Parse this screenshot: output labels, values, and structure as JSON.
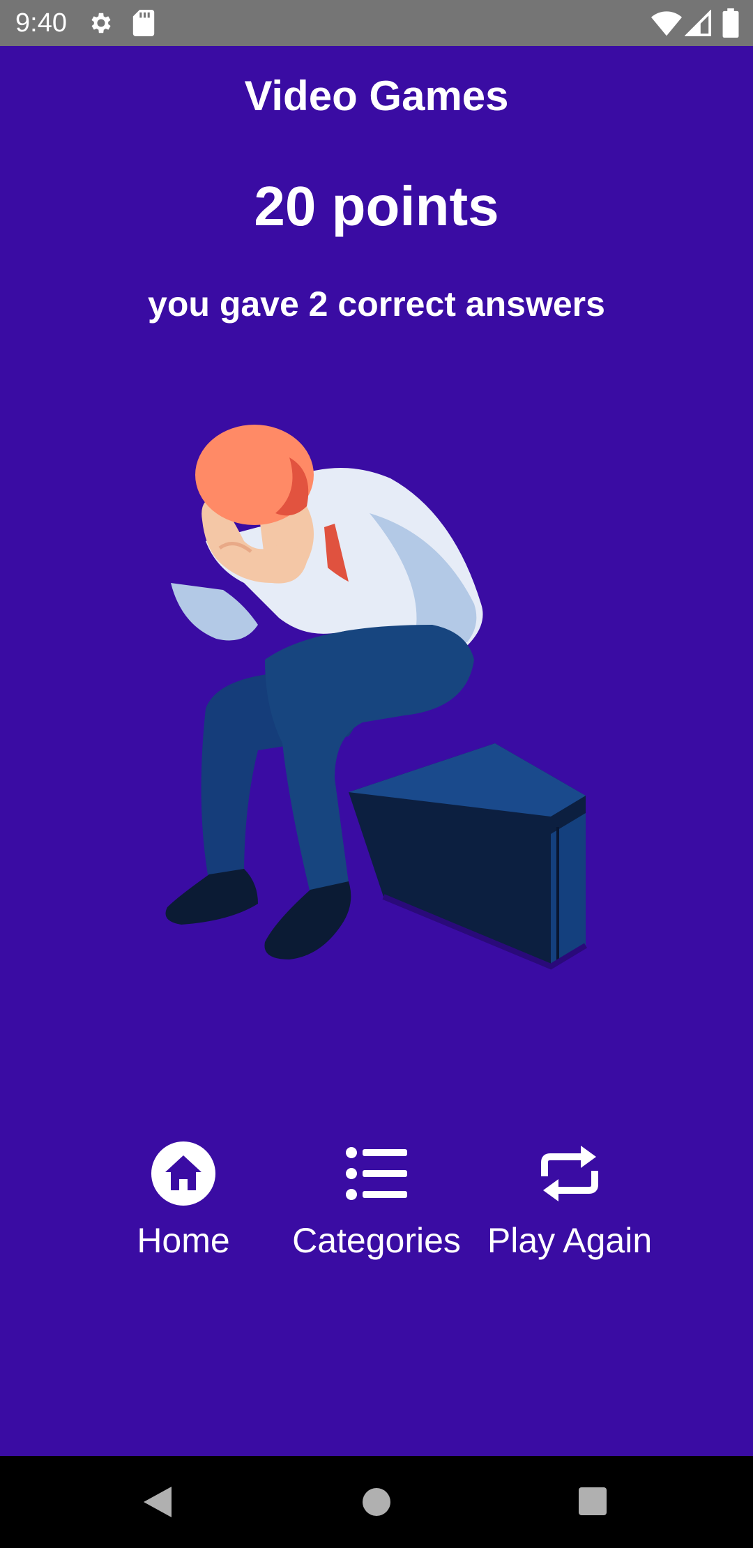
{
  "status_bar": {
    "time": "9:40",
    "icons": [
      "settings-icon",
      "sd-card-icon",
      "wifi-icon",
      "signal-icon",
      "battery-icon"
    ]
  },
  "result": {
    "category_title": "Video Games",
    "points_text": "20 points",
    "answers_text": "you gave 2 correct answers"
  },
  "illustration": {
    "icon": "sad-man-on-suitcase-illustration"
  },
  "actions": [
    {
      "label": "Home",
      "icon": "home-icon"
    },
    {
      "label": "Categories",
      "icon": "list-icon"
    },
    {
      "label": "Play Again",
      "icon": "repeat-icon"
    }
  ],
  "nav_bar": {
    "icons": [
      "back-icon",
      "home-circle-icon",
      "recents-icon"
    ]
  },
  "colors": {
    "background": "#3a0ca3",
    "status_bar": "#757575",
    "text": "#ffffff"
  }
}
